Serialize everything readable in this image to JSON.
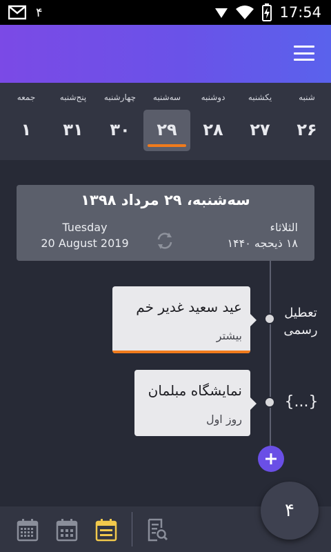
{
  "status_bar": {
    "notification_count": "۴",
    "time": "17:54"
  },
  "app_bar": {
    "menu_icon": "hamburger-menu-icon"
  },
  "week": {
    "days": [
      {
        "name": "شنبه",
        "num": "۲۶"
      },
      {
        "name": "یکشنبه",
        "num": "۲۷"
      },
      {
        "name": "دوشنبه",
        "num": "۲۸"
      },
      {
        "name": "سه‌شنبه",
        "num": "۲۹"
      },
      {
        "name": "چهارشنبه",
        "num": "۳۰"
      },
      {
        "name": "پنج‌شنبه",
        "num": "۳۱"
      },
      {
        "name": "جمعه",
        "num": "۱"
      }
    ],
    "selected_index": 3,
    "accent_color": "#f07b1c"
  },
  "date_card": {
    "title": "سه‌شنبه، ۲۹ مرداد ۱۳۹۸",
    "gregorian_weekday": "Tuesday",
    "gregorian_date": "20 August 2019",
    "hijri_weekday": "الثلاثاء",
    "hijri_date": "۱۸ ذیحجه ۱۴۴۰"
  },
  "timeline": {
    "events": [
      {
        "title": "عید سعید غدیر خم",
        "subtitle": "بیشتر",
        "category": "تعطیل رسمی",
        "category_line1": "تعطیل",
        "category_line2": "رسمی"
      },
      {
        "title": "نمایشگاه مبلمان",
        "subtitle": "روز اول",
        "category_symbol": "{...}"
      }
    ]
  },
  "fab": {
    "label": "۴"
  },
  "colors": {
    "background": "#272a36",
    "appbar_start": "#7b4ae6",
    "appbar_end": "#5a62ec",
    "accent": "#f07b1c",
    "add_button": "#6a4fe6",
    "active_nav_icon": "#f2c94c"
  },
  "bottom_nav": {
    "items": [
      "month-calendar-icon",
      "week-calendar-icon",
      "day-list-icon",
      "search-document-icon"
    ],
    "active_index": 2
  }
}
